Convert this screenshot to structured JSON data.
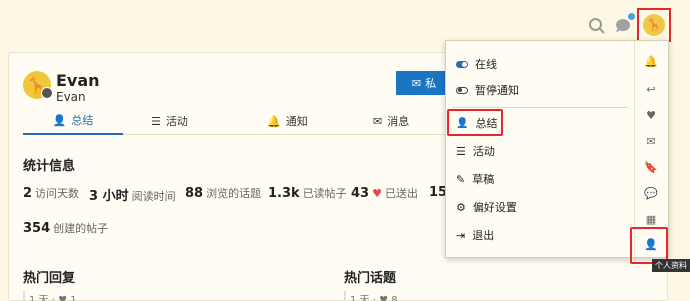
{
  "header": {
    "user_menu": {
      "items": [
        {
          "label": "在线"
        },
        {
          "label": "暂停通知"
        },
        {
          "label": "总结"
        },
        {
          "label": "活动"
        },
        {
          "label": "草稿"
        },
        {
          "label": "偏好设置"
        },
        {
          "label": "退出"
        }
      ],
      "tooltip": "个人资料"
    }
  },
  "profile": {
    "name": "Evan",
    "username": "Evan",
    "message_button": "私",
    "tabs": [
      {
        "label": "总结"
      },
      {
        "label": "活动"
      },
      {
        "label": "通知"
      },
      {
        "label": "消息"
      }
    ],
    "stats_title": "统计信息",
    "stats": [
      {
        "value": "2",
        "label": "访问天数"
      },
      {
        "value": "3 小时",
        "label": "阅读时间"
      },
      {
        "value": "88",
        "label": "浏览的话题"
      },
      {
        "value": "1.3k",
        "label": "已读帖子"
      },
      {
        "value": "43",
        "label": "已送出"
      },
      {
        "value": "15",
        "label": ""
      },
      {
        "value": "354",
        "label": "创建的帖子"
      }
    ],
    "top_replies_title": "热门回复",
    "top_topics_title": "热门话题",
    "reply_meta": "1 天 · ♥ 1",
    "topic_meta": "1 天 · ♥ 8"
  },
  "colors": {
    "accent": "#1a75c4",
    "highlight": "#e8262e",
    "background": "#fdf8e4"
  }
}
